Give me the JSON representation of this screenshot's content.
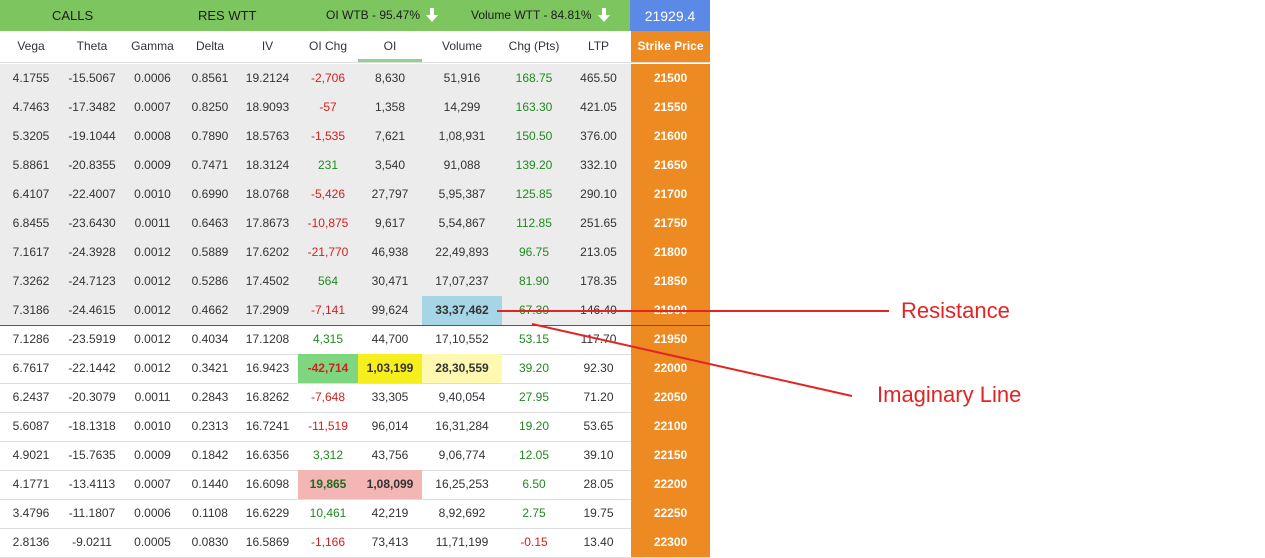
{
  "header": {
    "calls": "CALLS",
    "res": "RES WTT",
    "oi_wtb": "OI WTB - 95.47%",
    "volume_wtt": "Volume WTT - 84.81%",
    "spot": "21929.4"
  },
  "columns": [
    "Vega",
    "Theta",
    "Gamma",
    "Delta",
    "IV",
    "OI Chg",
    "OI",
    "Volume",
    "Chg (Pts)",
    "LTP",
    "Strike Price"
  ],
  "rows": [
    {
      "vega": "4.1755",
      "theta": "-15.5067",
      "gamma": "0.0006",
      "delta": "0.8561",
      "iv": "19.2124",
      "oichg": "-2,706",
      "oi": "8,630",
      "volume": "51,916",
      "chg": "168.75",
      "ltp": "465.50",
      "strike": "21500"
    },
    {
      "vega": "4.7463",
      "theta": "-17.3482",
      "gamma": "0.0007",
      "delta": "0.8250",
      "iv": "18.9093",
      "oichg": "-57",
      "oi": "1,358",
      "volume": "14,299",
      "chg": "163.30",
      "ltp": "421.05",
      "strike": "21550"
    },
    {
      "vega": "5.3205",
      "theta": "-19.1044",
      "gamma": "0.0008",
      "delta": "0.7890",
      "iv": "18.5763",
      "oichg": "-1,535",
      "oi": "7,621",
      "volume": "1,08,931",
      "chg": "150.50",
      "ltp": "376.00",
      "strike": "21600"
    },
    {
      "vega": "5.8861",
      "theta": "-20.8355",
      "gamma": "0.0009",
      "delta": "0.7471",
      "iv": "18.3124",
      "oichg": "231",
      "oi": "3,540",
      "volume": "91,088",
      "chg": "139.20",
      "ltp": "332.10",
      "strike": "21650"
    },
    {
      "vega": "6.4107",
      "theta": "-22.4007",
      "gamma": "0.0010",
      "delta": "0.6990",
      "iv": "18.0768",
      "oichg": "-5,426",
      "oi": "27,797",
      "volume": "5,95,387",
      "chg": "125.85",
      "ltp": "290.10",
      "strike": "21700"
    },
    {
      "vega": "6.8455",
      "theta": "-23.6430",
      "gamma": "0.0011",
      "delta": "0.6463",
      "iv": "17.8673",
      "oichg": "-10,875",
      "oi": "9,617",
      "volume": "5,54,867",
      "chg": "112.85",
      "ltp": "251.65",
      "strike": "21750"
    },
    {
      "vega": "7.1617",
      "theta": "-24.3928",
      "gamma": "0.0012",
      "delta": "0.5889",
      "iv": "17.6202",
      "oichg": "-21,770",
      "oi": "46,938",
      "volume": "22,49,893",
      "chg": "96.75",
      "ltp": "213.05",
      "strike": "21800"
    },
    {
      "vega": "7.3262",
      "theta": "-24.7123",
      "gamma": "0.0012",
      "delta": "0.5286",
      "iv": "17.4502",
      "oichg": "564",
      "oi": "30,471",
      "volume": "17,07,237",
      "chg": "81.90",
      "ltp": "178.35",
      "strike": "21850"
    },
    {
      "vega": "7.3186",
      "theta": "-24.4615",
      "gamma": "0.0012",
      "delta": "0.4662",
      "iv": "17.2909",
      "oichg": "-7,141",
      "oi": "99,624",
      "volume": "33,37,462",
      "chg": "67.30",
      "ltp": "146.40",
      "strike": "21900"
    },
    {
      "vega": "7.1286",
      "theta": "-23.5919",
      "gamma": "0.0012",
      "delta": "0.4034",
      "iv": "17.1208",
      "oichg": "4,315",
      "oi": "44,700",
      "volume": "17,10,552",
      "chg": "53.15",
      "ltp": "117.70",
      "strike": "21950"
    },
    {
      "vega": "6.7617",
      "theta": "-22.1442",
      "gamma": "0.0012",
      "delta": "0.3421",
      "iv": "16.9423",
      "oichg": "-42,714",
      "oi": "1,03,199",
      "volume": "28,30,559",
      "chg": "39.20",
      "ltp": "92.30",
      "strike": "22000"
    },
    {
      "vega": "6.2437",
      "theta": "-20.3079",
      "gamma": "0.0011",
      "delta": "0.2843",
      "iv": "16.8262",
      "oichg": "-7,648",
      "oi": "33,305",
      "volume": "9,40,054",
      "chg": "27.95",
      "ltp": "71.20",
      "strike": "22050"
    },
    {
      "vega": "5.6087",
      "theta": "-18.1318",
      "gamma": "0.0010",
      "delta": "0.2313",
      "iv": "16.7241",
      "oichg": "-11,519",
      "oi": "96,014",
      "volume": "16,31,284",
      "chg": "19.20",
      "ltp": "53.65",
      "strike": "22100"
    },
    {
      "vega": "4.9021",
      "theta": "-15.7635",
      "gamma": "0.0009",
      "delta": "0.1842",
      "iv": "16.6356",
      "oichg": "3,312",
      "oi": "43,756",
      "volume": "9,06,774",
      "chg": "12.05",
      "ltp": "39.10",
      "strike": "22150"
    },
    {
      "vega": "4.1771",
      "theta": "-13.4113",
      "gamma": "0.0007",
      "delta": "0.1440",
      "iv": "16.6098",
      "oichg": "19,865",
      "oi": "1,08,099",
      "volume": "16,25,253",
      "chg": "6.50",
      "ltp": "28.05",
      "strike": "22200"
    },
    {
      "vega": "3.4796",
      "theta": "-11.1807",
      "gamma": "0.0006",
      "delta": "0.1108",
      "iv": "16.6229",
      "oichg": "10,461",
      "oi": "42,219",
      "volume": "8,92,692",
      "chg": "2.75",
      "ltp": "19.75",
      "strike": "22250"
    },
    {
      "vega": "2.8136",
      "theta": "-9.0211",
      "gamma": "0.0005",
      "delta": "0.0830",
      "iv": "16.5869",
      "oichg": "-1,166",
      "oi": "73,413",
      "volume": "11,71,199",
      "chg": "-0.15",
      "ltp": "13.40",
      "strike": "22300"
    }
  ],
  "annotations": {
    "resistance": "Resistance",
    "imaginary_line": "Imaginary Line"
  },
  "colors": {
    "header_green": "#7dc65f",
    "spot_blue": "#5b8ae6",
    "strike_orange": "#ee8a22",
    "negative_red": "#d51e1e",
    "positive_green": "#1f8a1f",
    "annotation_red": "#e32424"
  }
}
